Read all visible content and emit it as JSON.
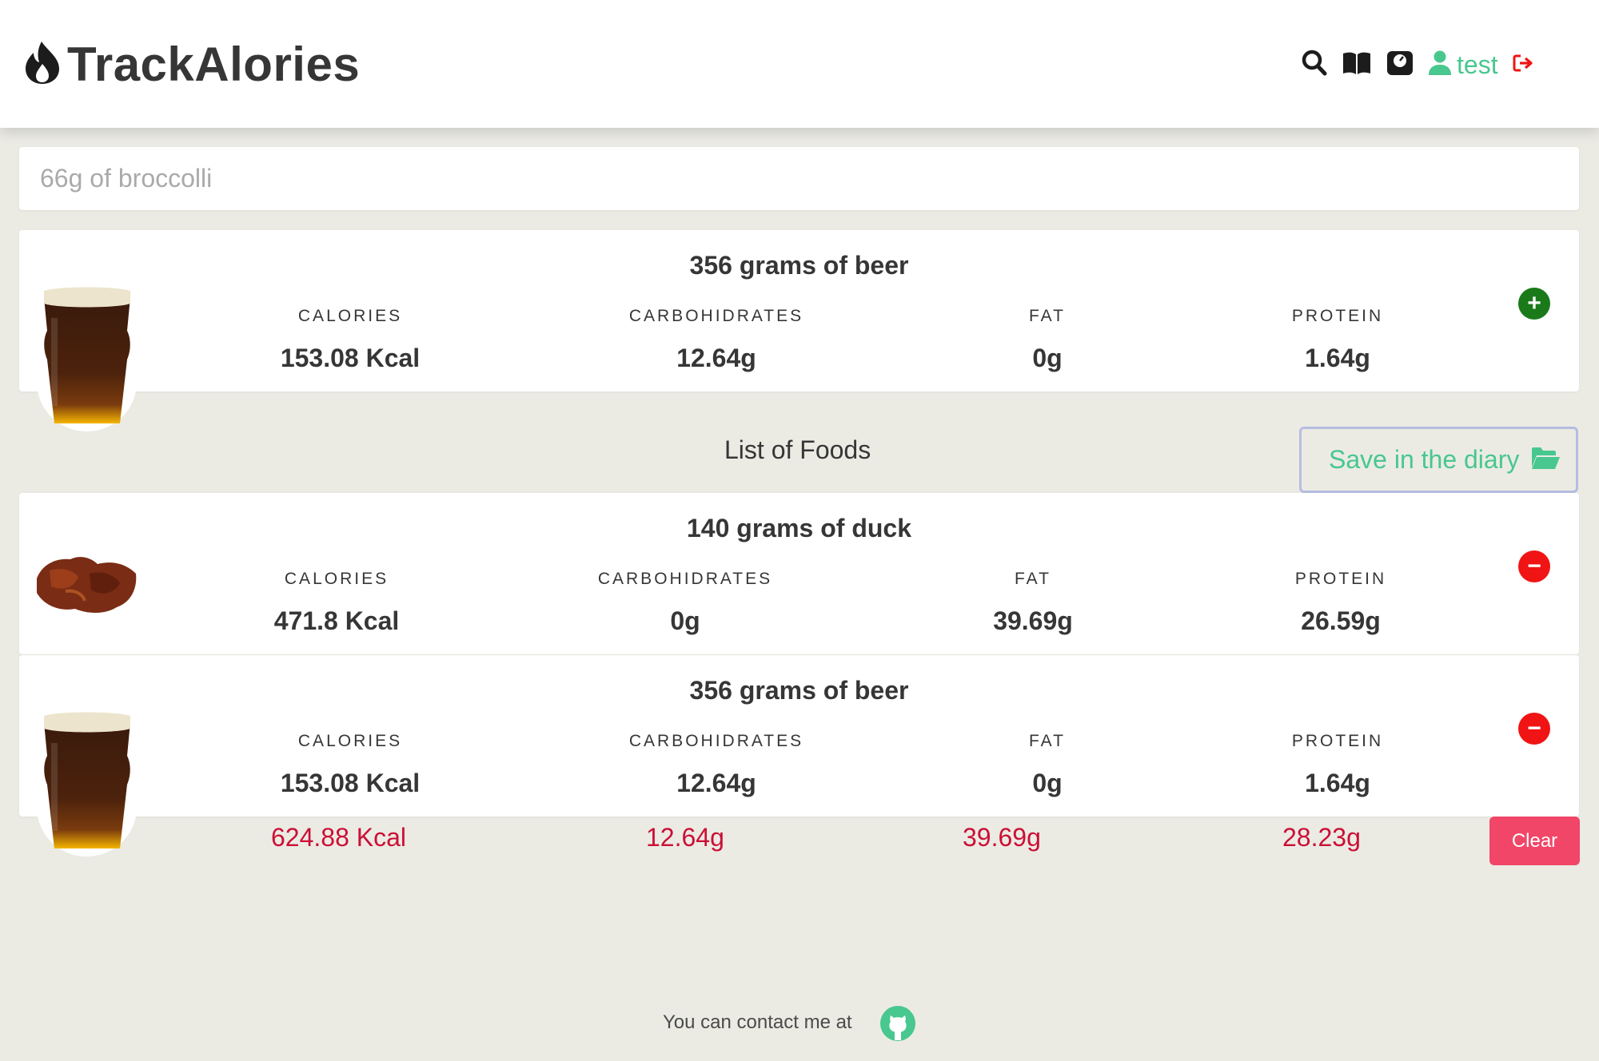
{
  "header": {
    "brand_title": "TrackAlories",
    "user_name": "test",
    "icons": [
      "fire-icon",
      "search-icon",
      "book-icon",
      "scale-icon",
      "user-icon",
      "logout-icon"
    ]
  },
  "search": {
    "placeholder": "66g of broccolli",
    "value": ""
  },
  "preview": {
    "title": "356 grams of beer",
    "image": "beer-image",
    "calories_label": "CALORIES",
    "calories": "153.08 Kcal",
    "carbs_label": "CARBOHIDRATES",
    "carbs": "12.64g",
    "fat_label": "FAT",
    "fat": "0g",
    "protein_label": "PROTEIN",
    "protein": "1.64g",
    "action": "+"
  },
  "list": {
    "title": "List of Foods",
    "save_label": "Save in the diary",
    "items": [
      {
        "title": "140 grams of duck",
        "image": "duck-image",
        "calories_label": "CALORIES",
        "calories": "471.8 Kcal",
        "carbs_label": "CARBOHIDRATES",
        "carbs": "0g",
        "fat_label": "FAT",
        "fat": "39.69g",
        "protein_label": "PROTEIN",
        "protein": "26.59g",
        "action": "−"
      },
      {
        "title": "356 grams of beer",
        "image": "beer-image",
        "calories_label": "CALORIES",
        "calories": "153.08 Kcal",
        "carbs_label": "CARBOHIDRATES",
        "carbs": "12.64g",
        "fat_label": "FAT",
        "fat": "0g",
        "protein_label": "PROTEIN",
        "protein": "1.64g",
        "action": "−"
      }
    ]
  },
  "totals": {
    "calories": "624.88 Kcal",
    "carbs": "12.64g",
    "fat": "39.69g",
    "protein": "28.23g",
    "clear_label": "Clear"
  },
  "footer": {
    "text": "You can contact me at"
  },
  "colors": {
    "background": "#ebebe4",
    "accent_green": "#48c78e",
    "add_green": "#1a7a1a",
    "remove_red": "#f01414",
    "totals_red": "#cc0f35",
    "clear_pink": "#f14668"
  }
}
